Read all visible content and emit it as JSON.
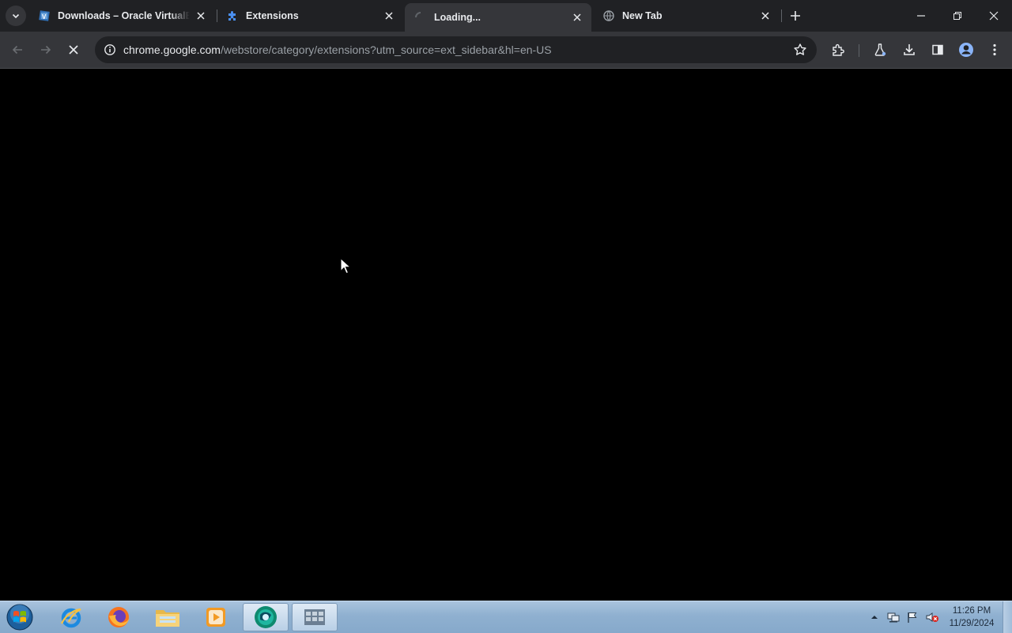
{
  "tabs": [
    {
      "title": "Downloads – Oracle VirtualBox",
      "favicon": "virtualbox-icon"
    },
    {
      "title": "Extensions",
      "favicon": "puzzle-icon"
    },
    {
      "title": "Loading...",
      "favicon": "spinner-icon",
      "active": true
    },
    {
      "title": "New Tab",
      "favicon": "globe-icon"
    }
  ],
  "omnibox": {
    "host": "chrome.google.com",
    "path": "/webstore/category/extensions?utm_source=ext_sidebar&hl=en-US"
  },
  "toolbar": {
    "back": "back-arrow-icon",
    "forward": "forward-arrow-icon",
    "stop": "stop-x-icon",
    "extensions": "puzzle-icon",
    "labs": "flask-icon",
    "downloads": "download-icon",
    "side_panel": "side-panel-icon",
    "profile": "profile-icon",
    "menu": "kebab-menu-icon"
  },
  "taskbar": {
    "clock_time": "11:26 PM",
    "clock_date": "11/29/2024",
    "apps": [
      "internet-explorer-icon",
      "firefox-icon",
      "file-explorer-icon",
      "media-player-icon",
      "chrome-app-icon",
      "app-icon"
    ]
  },
  "colors": {
    "tabstrip": "#202124",
    "toolbar": "#35363a",
    "omnibox": "#202124",
    "taskbar": "#8fb0d0"
  }
}
